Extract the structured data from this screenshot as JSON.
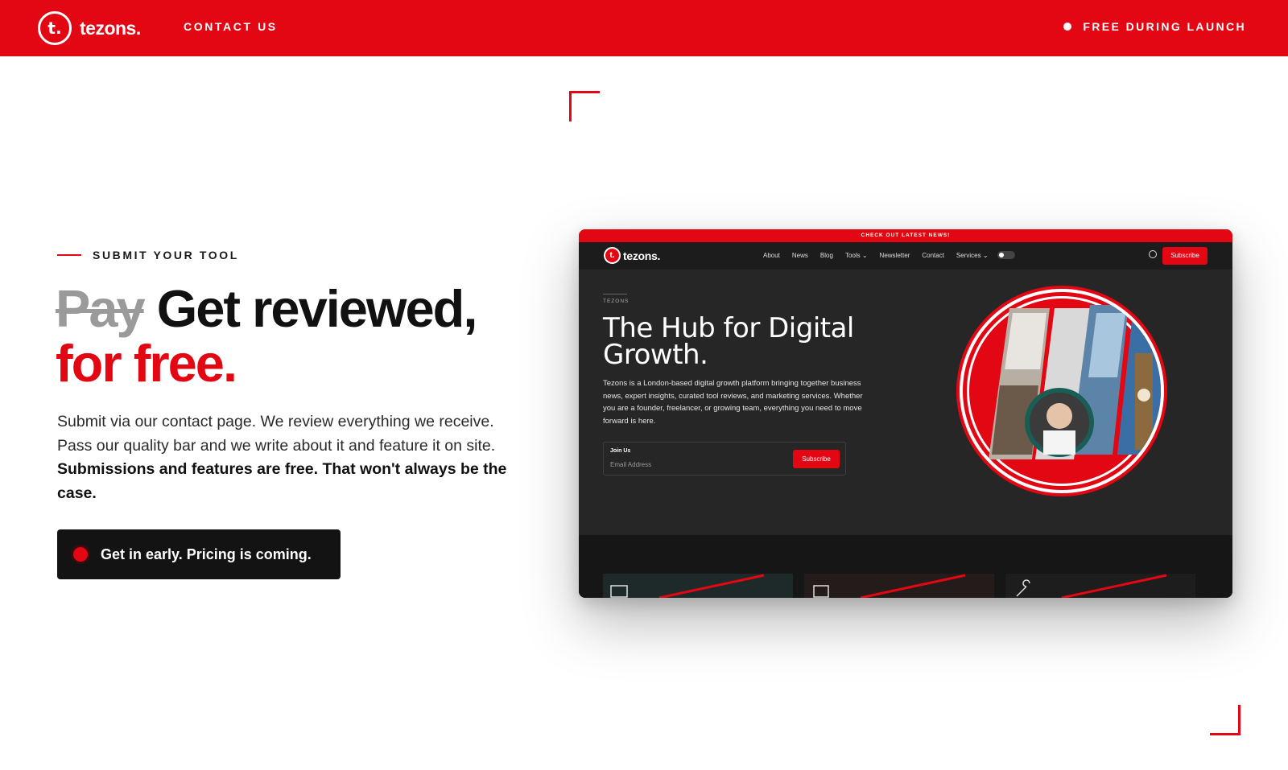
{
  "header": {
    "brand_mark": "t.",
    "brand_name": "tezons.",
    "contact_label": "CONTACT US",
    "launch_label": "FREE DURING LAUNCH"
  },
  "hero": {
    "eyebrow": "SUBMIT YOUR TOOL",
    "headline_struck": "Pay",
    "headline_main": "Get reviewed,",
    "headline_red": "for free.",
    "description_plain": "Submit via our contact page. We review everything we receive. Pass our quality bar and we write about it and feature it on site.",
    "description_bold": "Submissions and features are free. That won't always be the case.",
    "cta_label": "Get in early. Pricing is coming."
  },
  "preview": {
    "top_banner": "CHECK OUT LATEST NEWS!",
    "logo_mark": "t.",
    "logo_name": "tezons.",
    "nav": [
      "About",
      "News",
      "Blog",
      "Tools ⌄",
      "Newsletter",
      "Contact",
      "Services ⌄"
    ],
    "subscribe_label": "Subscribe",
    "eyebrow": "TEZONS",
    "title": "The Hub for Digital Growth.",
    "description": "Tezons is a London-based digital growth platform bringing together business news, expert insights, curated tool reviews, and marketing services. Whether you are a founder, freelancer, or growing team, everything you need to move forward is here.",
    "form_label": "Join Us",
    "form_placeholder": "Email Address",
    "form_button": "Subscribe"
  },
  "colors": {
    "brand_red": "#e30613",
    "dark": "#131313",
    "preview_bg": "#262626"
  }
}
